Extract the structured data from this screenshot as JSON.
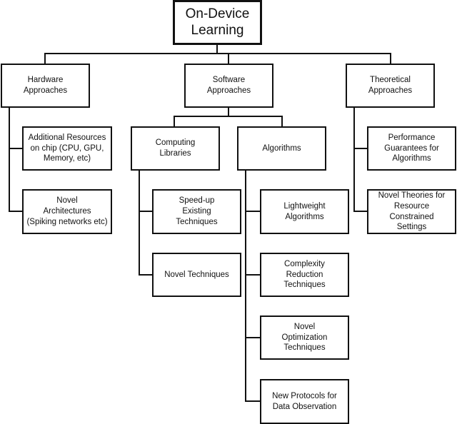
{
  "root": {
    "label": "On-Device\nLearning"
  },
  "level1": [
    {
      "label": "Hardware\nApproaches"
    },
    {
      "label": "Software\nApproaches"
    },
    {
      "label": "Theoretical\nApproaches"
    }
  ],
  "hardware_children": [
    {
      "label": "Additional Resources\non chip (CPU, GPU,\nMemory, etc)"
    },
    {
      "label": "Novel\nArchitectures\n(Spiking networks etc)"
    }
  ],
  "software_children": [
    {
      "label": "Computing\nLibraries"
    },
    {
      "label": "Algorithms"
    }
  ],
  "computing_libraries_children": [
    {
      "label": "Speed-up\nExisting\nTechniques"
    },
    {
      "label": "Novel Techniques"
    }
  ],
  "algorithms_children": [
    {
      "label": "Lightweight\nAlgorithms"
    },
    {
      "label": "Complexity\nReduction\nTechniques"
    },
    {
      "label": "Novel\nOptimization\nTechniques"
    },
    {
      "label": "New Protocols for\nData Observation"
    }
  ],
  "theoretical_children": [
    {
      "label": "Performance\nGuarantees for\nAlgorithms"
    },
    {
      "label": "Novel Theories for\nResource Constrained\nSettings"
    }
  ]
}
